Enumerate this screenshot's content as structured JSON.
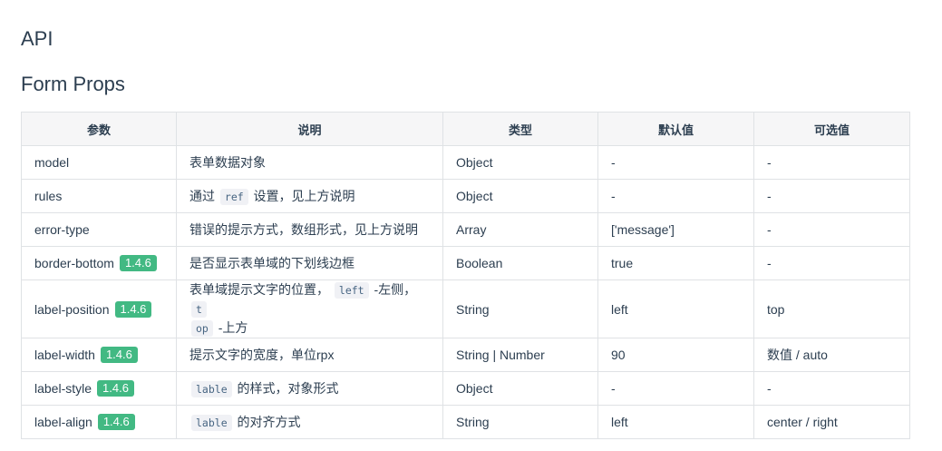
{
  "headings": {
    "api": "API",
    "form_props": "Form Props"
  },
  "table": {
    "headers": [
      "参数",
      "说明",
      "类型",
      "默认值",
      "可选值"
    ],
    "rows": [
      {
        "param": "model",
        "badge": "",
        "desc_parts": [
          {
            "t": "text",
            "v": "表单数据对象"
          }
        ],
        "type": "Object",
        "default": "-",
        "options": "-"
      },
      {
        "param": "rules",
        "badge": "",
        "desc_parts": [
          {
            "t": "text",
            "v": "通过 "
          },
          {
            "t": "code",
            "v": "ref"
          },
          {
            "t": "text",
            "v": " 设置，见上方说明"
          }
        ],
        "type": "Object",
        "default": "-",
        "options": "-"
      },
      {
        "param": "error-type",
        "badge": "",
        "desc_parts": [
          {
            "t": "text",
            "v": "错误的提示方式，数组形式，见上方说明"
          }
        ],
        "type": "Array",
        "default": "['message']",
        "options": "-"
      },
      {
        "param": "border-bottom",
        "badge": "1.4.6",
        "desc_parts": [
          {
            "t": "text",
            "v": "是否显示表单域的下划线边框"
          }
        ],
        "type": "Boolean",
        "default": "true",
        "options": "-"
      },
      {
        "param": "label-position",
        "badge": "1.4.6",
        "desc_parts": [
          {
            "t": "text",
            "v": "表单域提示文字的位置， "
          },
          {
            "t": "code",
            "v": "left"
          },
          {
            "t": "text",
            "v": " -左侧， "
          },
          {
            "t": "code",
            "v": "t"
          },
          {
            "t": "br",
            "v": ""
          },
          {
            "t": "code",
            "v": "op"
          },
          {
            "t": "text",
            "v": " -上方"
          }
        ],
        "type": "String",
        "default": "left",
        "options": "top",
        "tall": true
      },
      {
        "param": "label-width",
        "badge": "1.4.6",
        "desc_parts": [
          {
            "t": "text",
            "v": "提示文字的宽度，单位rpx"
          }
        ],
        "type": "String | Number",
        "default": "90",
        "options": "数值 / auto"
      },
      {
        "param": "label-style",
        "badge": "1.4.6",
        "desc_parts": [
          {
            "t": "code",
            "v": "lable"
          },
          {
            "t": "text",
            "v": " 的样式，对象形式"
          }
        ],
        "type": "Object",
        "default": "-",
        "options": "-"
      },
      {
        "param": "label-align",
        "badge": "1.4.6",
        "desc_parts": [
          {
            "t": "code",
            "v": "lable"
          },
          {
            "t": "text",
            "v": " 的对齐方式"
          }
        ],
        "type": "String",
        "default": "left",
        "options": "center / right"
      }
    ]
  },
  "colors": {
    "badge": "#42b983",
    "border": "#dfe2e5",
    "header_bg": "#f6f6f7",
    "text": "#2c3e50"
  }
}
